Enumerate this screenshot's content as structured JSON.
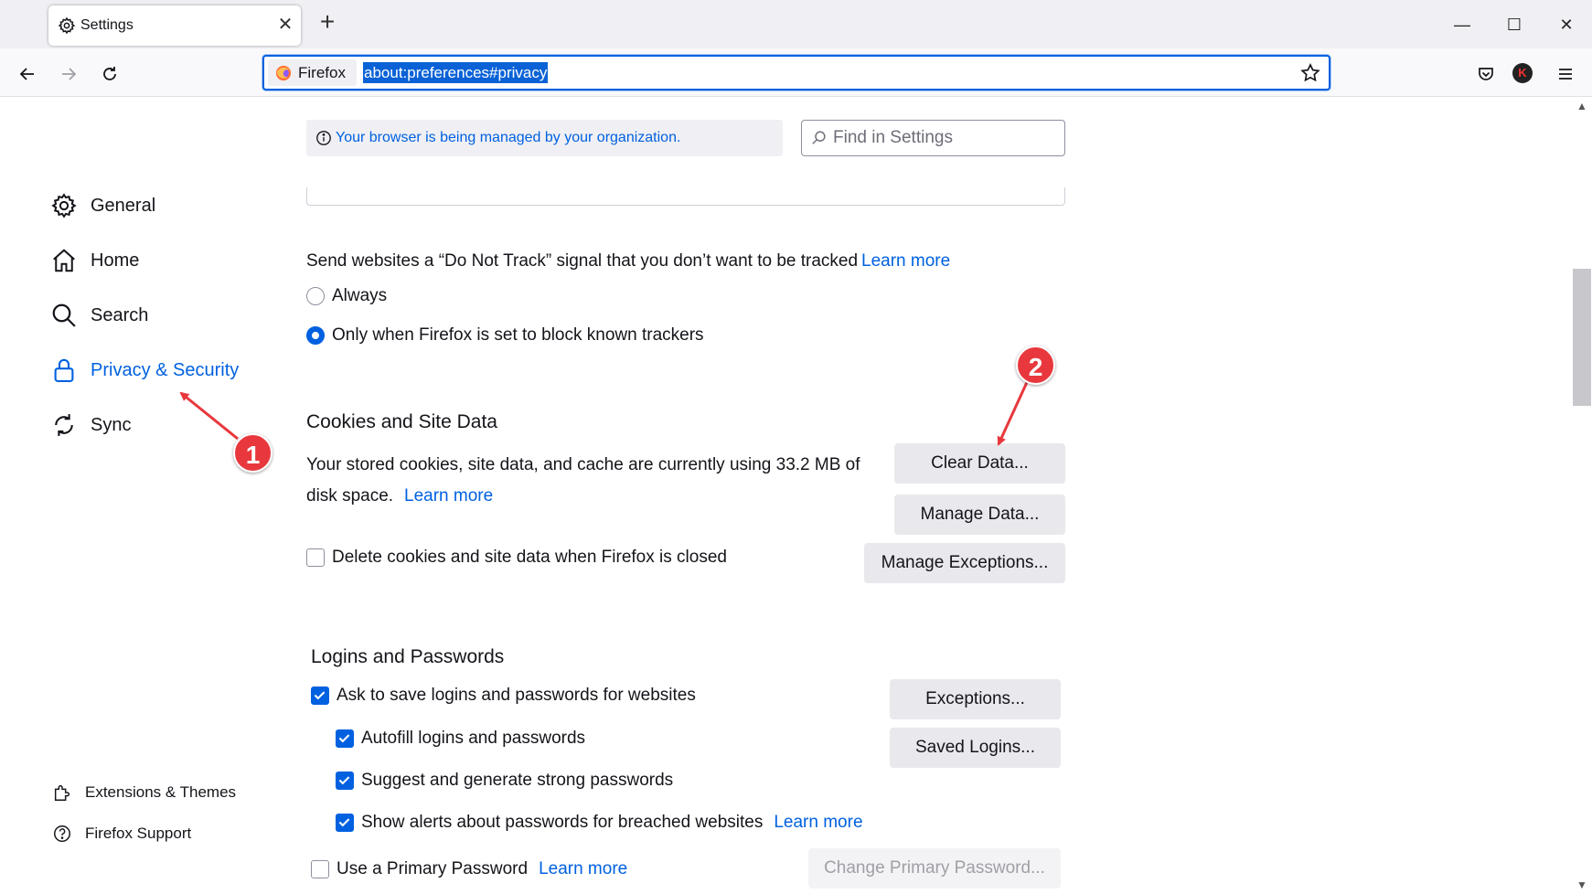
{
  "window": {
    "tab_title": "Settings",
    "minimize_glyph": "—",
    "maximize_glyph": "☐",
    "close_glyph": "✕",
    "tab_close_glyph": "✕",
    "new_tab_glyph": "+"
  },
  "navbar": {
    "identity_label": "Firefox",
    "url": "about:preferences#privacy",
    "avatar_letter": "K"
  },
  "sidebar": {
    "items": [
      {
        "label": "General",
        "icon": "gear-icon"
      },
      {
        "label": "Home",
        "icon": "home-icon"
      },
      {
        "label": "Search",
        "icon": "search-icon"
      },
      {
        "label": "Privacy & Security",
        "icon": "lock-icon",
        "selected": true
      },
      {
        "label": "Sync",
        "icon": "sync-icon"
      }
    ],
    "footer": [
      {
        "label": "Extensions & Themes",
        "icon": "puzzle-icon"
      },
      {
        "label": "Firefox Support",
        "icon": "help-icon"
      }
    ]
  },
  "header": {
    "managed_notice": "Your browser is being managed by your organization.",
    "find_placeholder": "Find in Settings"
  },
  "dnt": {
    "text": "Send websites a “Do Not Track” signal that you don’t want to be tracked",
    "learn_more": "Learn more",
    "options": [
      {
        "label": "Always",
        "selected": false
      },
      {
        "label": "Only when Firefox is set to block known trackers",
        "selected": true
      }
    ]
  },
  "cookies": {
    "heading": "Cookies and Site Data",
    "desc_line1": "Your stored cookies, site data, and cache are currently using 33.2 MB of",
    "desc_line2": "disk space.",
    "learn_more": "Learn more",
    "clear_button": "Clear Data...",
    "manage_button": "Manage Data...",
    "exceptions_button": "Manage Exceptions...",
    "delete_on_close_label": "Delete cookies and site data when Firefox is closed",
    "delete_on_close_checked": false
  },
  "logins": {
    "heading": "Logins and Passwords",
    "ask_save_label": "Ask to save logins and passwords for websites",
    "autofill_label": "Autofill logins and passwords",
    "suggest_label": "Suggest and generate strong passwords",
    "alerts_label": "Show alerts about passwords for breached websites",
    "alerts_learn_more": "Learn more",
    "primary_label": "Use a Primary Password",
    "primary_learn_more": "Learn more",
    "exceptions_button": "Exceptions...",
    "saved_logins_button": "Saved Logins...",
    "change_primary_button": "Change Primary Password..."
  },
  "annotations": {
    "badge1": "1",
    "badge2": "2",
    "color": "#e8383d"
  }
}
